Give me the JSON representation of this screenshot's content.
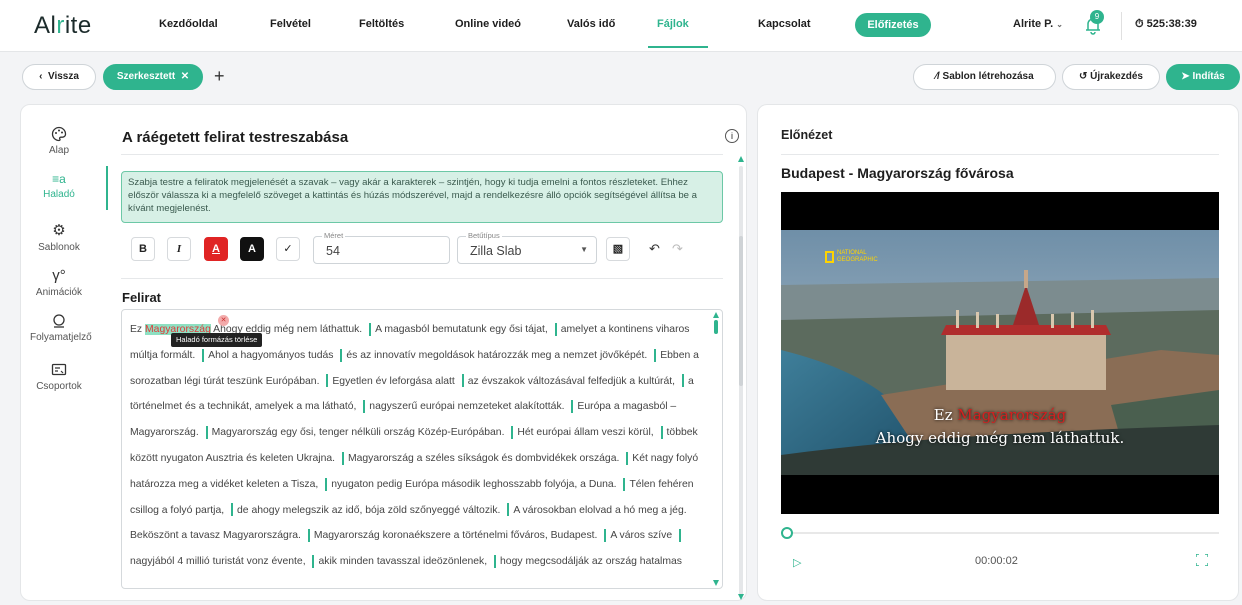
{
  "header": {
    "logo_part1": "Al",
    "logo_part2": "r",
    "logo_part3": "ite",
    "nav": [
      "Kezdőoldal",
      "Felvétel",
      "Feltöltés",
      "Online videó",
      "Valós idő",
      "Fájlok",
      "Kapcsolat"
    ],
    "active_nav": "Fájlok",
    "subscribe_label": "Előfizetés",
    "user_name": "Alrite P.",
    "notification_count": "9",
    "timer": "525:38:39"
  },
  "toolbar_row": {
    "back_label": "Vissza",
    "edited_tab_label": "Szerkesztett",
    "create_template_label": "Sablon létrehozása",
    "restart_label": "Újrakezdés",
    "start_label": "Indítás"
  },
  "sidebar": {
    "items": [
      {
        "label": "Alap",
        "icon": "palette-icon"
      },
      {
        "label": "Haladó",
        "icon": "advanced-icon"
      },
      {
        "label": "Sablonok",
        "icon": "gear-icon"
      },
      {
        "label": "Animációk",
        "icon": "animation-icon"
      },
      {
        "label": "Folyamatjelző",
        "icon": "progress-icon"
      },
      {
        "label": "Csoportok",
        "icon": "groups-icon"
      }
    ],
    "active": "Haladó"
  },
  "editor": {
    "title": "A ráégetett felirat testreszabása",
    "info_text": "Szabja testre a feliratok megjelenését a szavak – vagy akár a karakterek – szintjén, hogy ki tudja emelni a fontos részleteket. Ehhez először válassza ki a megfelelő szöveget a kattintás és húzás módszerével, majd a rendelkezésre álló opciók segítségével állítsa be a kívánt megjelenést.",
    "format": {
      "bold_label": "B",
      "italic_label": "I",
      "color_label": "A",
      "bg_label": "A",
      "size_label": "Méret",
      "size_value": "54",
      "font_label": "Betűtípus",
      "font_value": "Zilla Slab"
    },
    "subtitle_label": "Felirat",
    "tooltip": "Haladó formázás törlése",
    "highlighted_word": "Magyarország",
    "segments": [
      "Ez Magyarország Ahogy eddig még nem láthattuk.",
      "A magasból bemutatunk egy ősi tájat,",
      "amelyet a kontinens viharos múltja formált.",
      "Ahol a hagyományos tudás",
      "és az innovatív megoldások határozzák meg a nemzet jövőképét.",
      "Ebben a sorozatban légi túrát teszünk Európában.",
      "Egyetlen év leforgása alatt",
      "az évszakok változásával felfedjük a kultúrát,",
      "a történelmet és a technikát, amelyek a ma látható,",
      "nagyszerű európai nemzeteket alakították.",
      "Európa a magasból – Magyarország.",
      "Magyarország egy ősi, tenger nélküli ország Közép-Európában.",
      "Hét európai állam veszi körül,",
      "többek között nyugaton Ausztria és keleten Ukrajna.",
      "Magyarország a széles síkságok és dombvidékek országa.",
      "Két nagy folyó határozza meg a vidéket keleten a Tisza,",
      "nyugaton pedig Európa második leghosszabb folyója, a Duna.",
      "Télen fehéren csillog a folyó partja,",
      "de ahogy melegszik az idő, bója zöld szőnyeggé változik.",
      "A városokban elolvad a hó meg a jég. Beköszönt a tavasz Magyarországra.",
      "Magyarország koronaékszere a történelmi főváros, Budapest.",
      "A város szíve",
      "nagyjából 4 millió turistát vonz évente,",
      "akik minden tavasszal ideözönlenek,",
      "hogy megcsodálják az ország hatalmas"
    ]
  },
  "preview": {
    "title": "Előnézet",
    "video_title": "Budapest - Magyarország fővárosa",
    "natgeo_line1": "NATIONAL",
    "natgeo_line2": "GEOGRAPHIC",
    "sub_line1_a": "Ez",
    "sub_line1_b": "Magyarország",
    "sub_line2": "Ahogy eddig még nem láthattuk.",
    "timecode": "00:00:02"
  },
  "colors": {
    "accent": "#2fb48e",
    "highlight_bg": "#8ee0c2",
    "highlight_text": "#e03a3a",
    "info_bg": "#d7f0e6"
  }
}
